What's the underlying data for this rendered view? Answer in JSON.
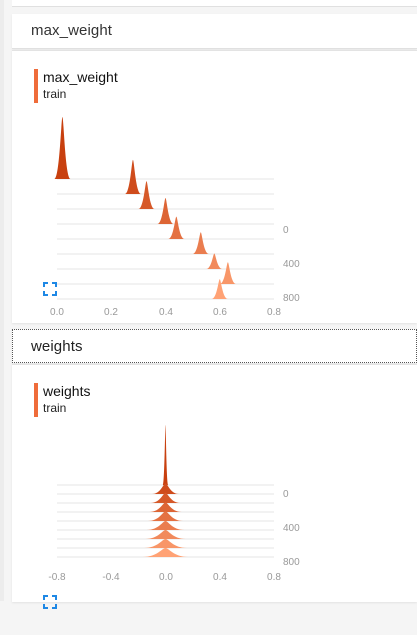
{
  "sections": [
    {
      "title": "max_weight",
      "run_name": "max_weight",
      "run_tag": "train",
      "x_ticks": [
        "0.0",
        "0.2",
        "0.4",
        "0.6",
        "0.8"
      ],
      "y_ticks": [
        "0",
        "400",
        "800"
      ]
    },
    {
      "title": "weights",
      "run_name": "weights",
      "run_tag": "train",
      "x_ticks": [
        "-0.8",
        "-0.4",
        "0.0",
        "0.4",
        "0.8"
      ],
      "y_ticks": [
        "0",
        "400",
        "800"
      ]
    }
  ],
  "colors": {
    "accent": "#ef6c3a",
    "icon": "#1e88e5",
    "dark_hist": "#c8400f",
    "light_hist": "#ffa275"
  },
  "icons": {
    "expand": "fullscreen-icon"
  },
  "chart_data": [
    {
      "type": "area",
      "title": "max_weight",
      "xlabel": "",
      "ylabel": "",
      "xlim": [
        0.0,
        0.8
      ],
      "steps": [
        0,
        100,
        200,
        300,
        400,
        500,
        600,
        700,
        800
      ],
      "peaks": [
        {
          "x": 0.02,
          "h": 1.0
        },
        {
          "x": 0.28,
          "h": 0.55
        },
        {
          "x": 0.33,
          "h": 0.45
        },
        {
          "x": 0.4,
          "h": 0.42
        },
        {
          "x": 0.44,
          "h": 0.36
        },
        {
          "x": 0.53,
          "h": 0.35
        },
        {
          "x": 0.58,
          "h": 0.25
        },
        {
          "x": 0.63,
          "h": 0.35
        },
        {
          "x": 0.6,
          "h": 0.32
        }
      ]
    },
    {
      "type": "area",
      "title": "weights",
      "xlabel": "",
      "ylabel": "",
      "xlim": [
        -0.8,
        0.8
      ],
      "steps": [
        0,
        100,
        200,
        300,
        400,
        500,
        600,
        700,
        800
      ],
      "peaks": [
        {
          "x": 0.0,
          "h": 1.0,
          "w": 0.02
        },
        {
          "x": 0.0,
          "h": 0.18,
          "w": 0.1
        },
        {
          "x": 0.0,
          "h": 0.17,
          "w": 0.11
        },
        {
          "x": 0.0,
          "h": 0.16,
          "w": 0.12
        },
        {
          "x": 0.0,
          "h": 0.16,
          "w": 0.13
        },
        {
          "x": 0.0,
          "h": 0.15,
          "w": 0.14
        },
        {
          "x": 0.0,
          "h": 0.15,
          "w": 0.15
        },
        {
          "x": 0.0,
          "h": 0.15,
          "w": 0.16
        },
        {
          "x": 0.0,
          "h": 0.15,
          "w": 0.17
        }
      ]
    }
  ]
}
